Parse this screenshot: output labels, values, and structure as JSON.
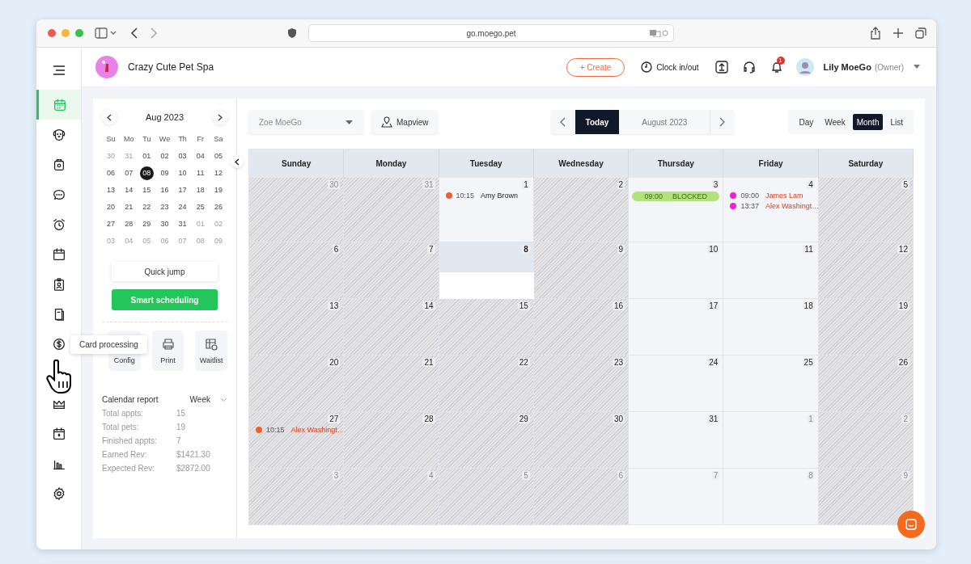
{
  "browser": {
    "url": "go.moego.pet"
  },
  "header": {
    "business": "Crazy Cute Pet Spa",
    "create": "+ Create",
    "clock": "Clock in/out",
    "notifications": "1",
    "user": "Lily MoeGo",
    "role": "(Owner)"
  },
  "sidebar": {
    "items": [
      {
        "selected": true
      },
      {
        "selected": false
      },
      {
        "selected": false
      },
      {
        "selected": false
      },
      {
        "selected": false
      },
      {
        "selected": false
      },
      {
        "selected": false
      },
      {
        "selected": false
      },
      {
        "selected": false
      },
      {
        "selected": false
      },
      {
        "selected": false
      },
      {
        "selected": false
      },
      {
        "selected": false
      }
    ],
    "tooltip": "Card processing"
  },
  "mini_calendar": {
    "title": "Aug 2023",
    "weekdays": [
      "Su",
      "Mo",
      "Tu",
      "We",
      "Th",
      "Fr",
      "Sa"
    ],
    "days": [
      {
        "day": "30",
        "muted": true,
        "selected": false
      },
      {
        "day": "31",
        "muted": true,
        "selected": false
      },
      {
        "day": "01",
        "muted": false,
        "selected": false
      },
      {
        "day": "02",
        "muted": false,
        "selected": false
      },
      {
        "day": "03",
        "muted": false,
        "selected": false
      },
      {
        "day": "04",
        "muted": false,
        "selected": false
      },
      {
        "day": "05",
        "muted": false,
        "selected": false
      },
      {
        "day": "06",
        "muted": false,
        "selected": false
      },
      {
        "day": "07",
        "muted": false,
        "selected": false
      },
      {
        "day": "08",
        "muted": false,
        "selected": true
      },
      {
        "day": "09",
        "muted": false,
        "selected": false
      },
      {
        "day": "10",
        "muted": false,
        "selected": false
      },
      {
        "day": "11",
        "muted": false,
        "selected": false
      },
      {
        "day": "12",
        "muted": false,
        "selected": false
      },
      {
        "day": "13",
        "muted": false,
        "selected": false
      },
      {
        "day": "14",
        "muted": false,
        "selected": false
      },
      {
        "day": "15",
        "muted": false,
        "selected": false
      },
      {
        "day": "16",
        "muted": false,
        "selected": false
      },
      {
        "day": "17",
        "muted": false,
        "selected": false
      },
      {
        "day": "18",
        "muted": false,
        "selected": false
      },
      {
        "day": "19",
        "muted": false,
        "selected": false
      },
      {
        "day": "20",
        "muted": false,
        "selected": false
      },
      {
        "day": "21",
        "muted": false,
        "selected": false
      },
      {
        "day": "22",
        "muted": false,
        "selected": false
      },
      {
        "day": "23",
        "muted": false,
        "selected": false
      },
      {
        "day": "24",
        "muted": false,
        "selected": false
      },
      {
        "day": "25",
        "muted": false,
        "selected": false
      },
      {
        "day": "26",
        "muted": false,
        "selected": false
      },
      {
        "day": "27",
        "muted": false,
        "selected": false
      },
      {
        "day": "28",
        "muted": false,
        "selected": false
      },
      {
        "day": "29",
        "muted": false,
        "selected": false
      },
      {
        "day": "30",
        "muted": false,
        "selected": false
      },
      {
        "day": "31",
        "muted": false,
        "selected": false
      },
      {
        "day": "01",
        "muted": true,
        "selected": false
      },
      {
        "day": "02",
        "muted": true,
        "selected": false
      },
      {
        "day": "03",
        "muted": true,
        "selected": false
      },
      {
        "day": "04",
        "muted": true,
        "selected": false
      },
      {
        "day": "05",
        "muted": true,
        "selected": false
      },
      {
        "day": "06",
        "muted": true,
        "selected": false
      },
      {
        "day": "07",
        "muted": true,
        "selected": false
      },
      {
        "day": "08",
        "muted": true,
        "selected": false
      },
      {
        "day": "09",
        "muted": true,
        "selected": false
      }
    ]
  },
  "buttons": {
    "quick_jump": "Quick jump",
    "smart": "Smart scheduling"
  },
  "tools": [
    {
      "label": "Config"
    },
    {
      "label": "Print"
    },
    {
      "label": "Waitlist"
    }
  ],
  "report": {
    "title": "Calendar report",
    "period": "Week",
    "stats": [
      {
        "label": "Total appts:",
        "value": "15"
      },
      {
        "label": "Total pets:",
        "value": "19"
      },
      {
        "label": "Finished appts:",
        "value": "7"
      },
      {
        "label": "Earned Rev:",
        "value": "$1421.30"
      },
      {
        "label": "Expected Rev:",
        "value": "$2872.00"
      }
    ]
  },
  "toolbar": {
    "staff": "Zoe MoeGo",
    "mapview": "Mapview",
    "today": {
      "label": "Today",
      "selected": true
    },
    "period": "August 2023",
    "views": [
      {
        "label": "Day",
        "selected": false
      },
      {
        "label": "Week",
        "selected": false
      },
      {
        "label": "Month",
        "selected": true
      },
      {
        "label": "List",
        "selected": false
      }
    ]
  },
  "calendar": {
    "weekdays": [
      "Sunday",
      "Monday",
      "Tuesday",
      "Wednesday",
      "Thursday",
      "Friday",
      "Saturday"
    ],
    "days": [
      {
        "day": "30",
        "muted": true,
        "closed": true,
        "today": false
      },
      {
        "day": "31",
        "muted": true,
        "closed": true,
        "today": false
      },
      {
        "day": "1",
        "muted": false,
        "closed": false,
        "today": false,
        "events": [
          {
            "kind": "appointment",
            "time": "10:15",
            "name": "Amy Brown",
            "color": "#f0602a",
            "flagged": false
          }
        ]
      },
      {
        "day": "2",
        "muted": false,
        "closed": true,
        "today": false
      },
      {
        "day": "3",
        "muted": false,
        "closed": false,
        "today": false,
        "events": [
          {
            "kind": "blocked",
            "time": "09:00",
            "name": "BLOCKED",
            "color": "#b3e27d"
          }
        ]
      },
      {
        "day": "4",
        "muted": false,
        "closed": false,
        "today": false,
        "events": [
          {
            "kind": "appointment",
            "time": "09:00",
            "name": "James Lam",
            "color": "#f020d8",
            "flagged": true
          },
          {
            "kind": "appointment",
            "time": "13:37",
            "name": "Alex Washingt…",
            "color": "#f020d8",
            "flagged": true
          }
        ]
      },
      {
        "day": "5",
        "muted": false,
        "closed": true,
        "today": false
      },
      {
        "day": "6",
        "muted": false,
        "closed": true,
        "today": false
      },
      {
        "day": "7",
        "muted": false,
        "closed": true,
        "today": false
      },
      {
        "day": "8",
        "muted": false,
        "closed": false,
        "today": true
      },
      {
        "day": "9",
        "muted": false,
        "closed": true,
        "today": false
      },
      {
        "day": "10",
        "muted": false,
        "closed": false,
        "today": false
      },
      {
        "day": "11",
        "muted": false,
        "closed": false,
        "today": false
      },
      {
        "day": "12",
        "muted": false,
        "closed": true,
        "today": false
      },
      {
        "day": "13",
        "muted": false,
        "closed": true,
        "today": false
      },
      {
        "day": "14",
        "muted": false,
        "closed": true,
        "today": false
      },
      {
        "day": "15",
        "muted": false,
        "closed": true,
        "today": false
      },
      {
        "day": "16",
        "muted": false,
        "closed": true,
        "today": false
      },
      {
        "day": "17",
        "muted": false,
        "closed": false,
        "today": false
      },
      {
        "day": "18",
        "muted": false,
        "closed": false,
        "today": false
      },
      {
        "day": "19",
        "muted": false,
        "closed": true,
        "today": false
      },
      {
        "day": "20",
        "muted": false,
        "closed": true,
        "today": false
      },
      {
        "day": "21",
        "muted": false,
        "closed": true,
        "today": false
      },
      {
        "day": "22",
        "muted": false,
        "closed": true,
        "today": false
      },
      {
        "day": "23",
        "muted": false,
        "closed": true,
        "today": false
      },
      {
        "day": "24",
        "muted": false,
        "closed": false,
        "today": false
      },
      {
        "day": "25",
        "muted": false,
        "closed": false,
        "today": false
      },
      {
        "day": "26",
        "muted": false,
        "closed": true,
        "today": false
      },
      {
        "day": "27",
        "muted": false,
        "closed": true,
        "today": false,
        "events": [
          {
            "kind": "appointment",
            "time": "10:15",
            "name": "Alex Washingt…",
            "color": "#f0602a",
            "flagged": true
          }
        ]
      },
      {
        "day": "28",
        "muted": false,
        "closed": true,
        "today": false
      },
      {
        "day": "29",
        "muted": false,
        "closed": true,
        "today": false
      },
      {
        "day": "30",
        "muted": false,
        "closed": true,
        "today": false
      },
      {
        "day": "31",
        "muted": false,
        "closed": false,
        "today": false
      },
      {
        "day": "1",
        "muted": true,
        "closed": false,
        "today": false
      },
      {
        "day": "2",
        "muted": true,
        "closed": true,
        "today": false
      },
      {
        "day": "3",
        "muted": true,
        "closed": true,
        "today": false
      },
      {
        "day": "4",
        "muted": true,
        "closed": true,
        "today": false
      },
      {
        "day": "5",
        "muted": true,
        "closed": true,
        "today": false
      },
      {
        "day": "6",
        "muted": true,
        "closed": true,
        "today": false
      },
      {
        "day": "7",
        "muted": true,
        "closed": false,
        "today": false
      },
      {
        "day": "8",
        "muted": true,
        "closed": false,
        "today": false
      },
      {
        "day": "9",
        "muted": true,
        "closed": true,
        "today": false
      }
    ]
  }
}
